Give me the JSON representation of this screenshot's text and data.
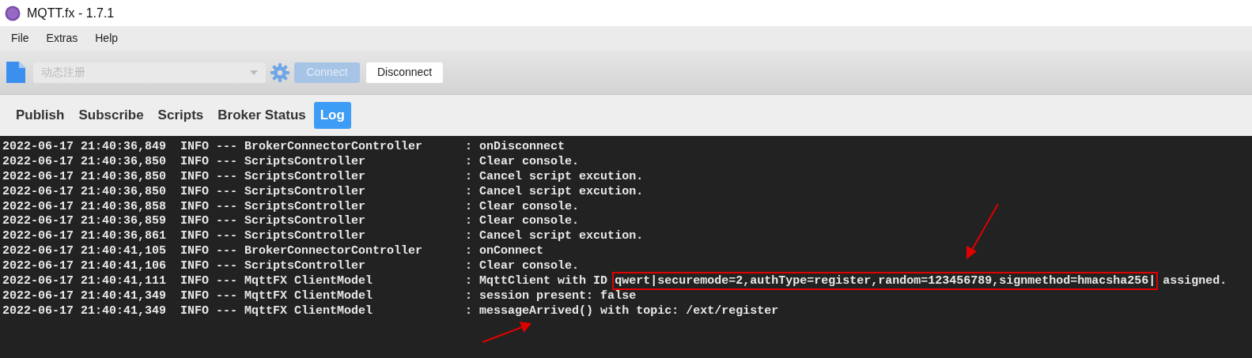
{
  "window": {
    "title": "MQTT.fx - 1.7.1"
  },
  "menu": [
    {
      "label": "File"
    },
    {
      "label": "Extras"
    },
    {
      "label": "Help"
    }
  ],
  "toolbar": {
    "profile": {
      "value": "动态注册",
      "disabled": true
    },
    "buttons": [
      {
        "label": "Connect",
        "disabled": true
      },
      {
        "label": "Disconnect",
        "disabled": false
      }
    ]
  },
  "tabs": [
    {
      "label": "Publish",
      "selected": false
    },
    {
      "label": "Subscribe",
      "selected": false
    },
    {
      "label": "Scripts",
      "selected": false
    },
    {
      "label": "Broker Status",
      "selected": false
    },
    {
      "label": "Log",
      "selected": true
    }
  ],
  "log": {
    "lines": [
      {
        "text": "2022-06-17 21:40:36,849  INFO --- BrokerConnectorController      : onDisconnect"
      },
      {
        "text": "2022-06-17 21:40:36,850  INFO --- ScriptsController              : Clear console."
      },
      {
        "text": "2022-06-17 21:40:36,850  INFO --- ScriptsController              : Cancel script excution."
      },
      {
        "text": "2022-06-17 21:40:36,850  INFO --- ScriptsController              : Cancel script excution."
      },
      {
        "text": "2022-06-17 21:40:36,858  INFO --- ScriptsController              : Clear console."
      },
      {
        "text": "2022-06-17 21:40:36,859  INFO --- ScriptsController              : Clear console."
      },
      {
        "text": "2022-06-17 21:40:36,861  INFO --- ScriptsController              : Cancel script excution."
      },
      {
        "text": "2022-06-17 21:40:41,105  INFO --- BrokerConnectorController      : onConnect"
      },
      {
        "text": "2022-06-17 21:40:41,106  INFO --- ScriptsController              : Clear console."
      },
      {
        "text": "2022-06-17 21:40:41,111  INFO --- MqttFX ClientModel             : MqttClient with ID",
        "highlighted": "qwert|securemode=2,authType=register,random=123456789,signmethod=hmacsha256|",
        "rest": "assigned."
      },
      {
        "text": "2022-06-17 21:40:41,349  INFO --- MqttFX ClientModel             : session present: false"
      },
      {
        "text": "2022-06-17 21:40:41,349  INFO --- MqttFX ClientModel             : messageArrived() with topic: /ext/register"
      }
    ]
  }
}
